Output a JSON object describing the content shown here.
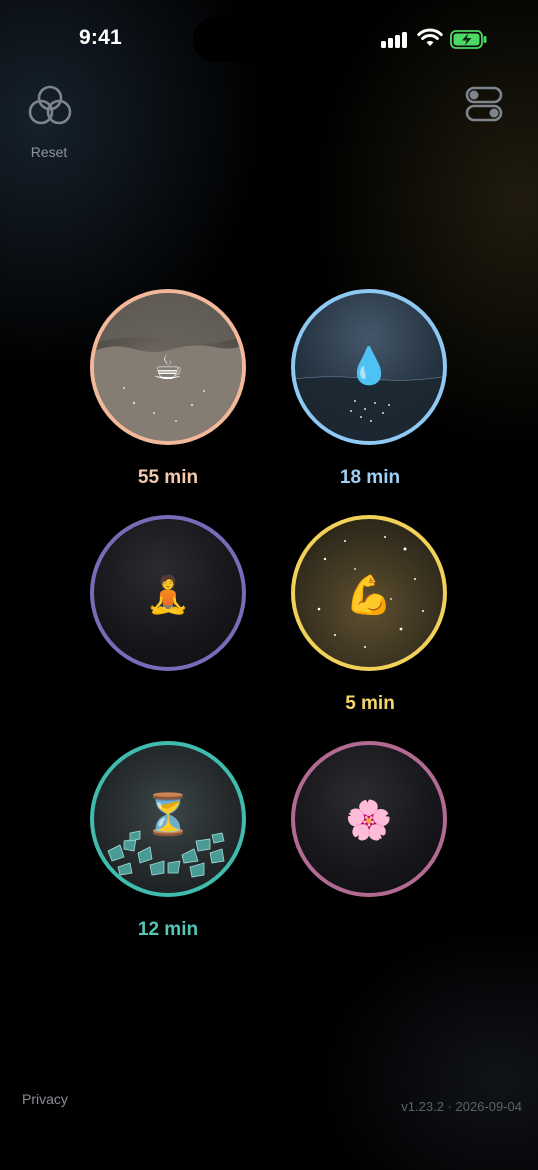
{
  "status_bar": {
    "time": "9:41",
    "icons": [
      "signal-icon",
      "wifi-icon",
      "battery-charging-icon"
    ],
    "battery_color": "#4cd964"
  },
  "header": {
    "reset_label": "Reset",
    "reset_icon": "three-rings-icon",
    "settings_icon": "toggles-icon"
  },
  "timers": [
    {
      "name": "coffee",
      "icon": "coffee-cup-icon",
      "glyph": "☕",
      "duration": "55 min",
      "ring_color": "#f2b89a",
      "label_color": "#f4c9b0"
    },
    {
      "name": "water",
      "icon": "water-drop-icon",
      "glyph": "💧",
      "duration": "18 min",
      "ring_color": "#8ec9f3",
      "label_color": "#9fd0f5"
    },
    {
      "name": "meditation",
      "icon": "meditation-icon",
      "glyph": "🧘",
      "duration": "",
      "ring_color": "#7a6ab8",
      "label_color": "#a99be0"
    },
    {
      "name": "strength",
      "icon": "flexed-bicep-icon",
      "glyph": "💪",
      "duration": "5 min",
      "ring_color": "#f2d15a",
      "label_color": "#f5d66a"
    },
    {
      "name": "hourglass",
      "icon": "hourglass-icon",
      "glyph": "⏳",
      "duration": "12 min",
      "ring_color": "#3fbcae",
      "label_color": "#55c7b8"
    },
    {
      "name": "flower",
      "icon": "cherry-blossom-icon",
      "glyph": "🌸",
      "duration": "",
      "ring_color": "#b26a93",
      "label_color": "#d08bb3"
    }
  ],
  "footer": {
    "privacy_label": "Privacy",
    "version": "v1.23.2 · 2026-09-04"
  }
}
